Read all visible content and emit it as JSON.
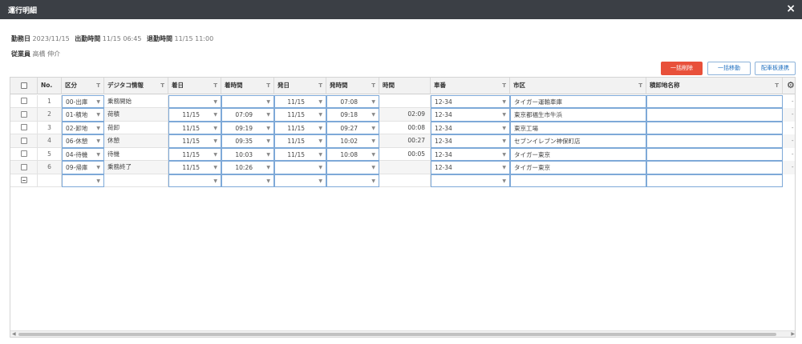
{
  "window": {
    "title": "運行明細",
    "close_icon": "×"
  },
  "info": {
    "work_date_label": "勤務日",
    "work_date": "2023/11/15",
    "clock_in_label": "出勤時間",
    "clock_in": "11/15 06:45",
    "clock_out_label": "退勤時間",
    "clock_out": "11/15 11:00",
    "employee_label": "従業員",
    "employee": "高橋 伸介"
  },
  "actions": {
    "bulk_delete": "一括削除",
    "bulk_move": "一括移動",
    "dispatch_link": "配車板連携"
  },
  "colors": {
    "titlebar": "#3b3f45",
    "danger": "#e8503a",
    "accent": "#1e6fc0"
  },
  "columns": {
    "no": "No.",
    "kubun": "区分",
    "digitaco": "デジタコ情報",
    "arrive_date": "着日",
    "arrive_time": "着時間",
    "depart_date": "発日",
    "depart_time": "発時間",
    "duration": "時間",
    "vehicle": "車番",
    "city": "市区",
    "place": "積卸地名称",
    "filter_icon": "T",
    "settings_icon": "⚙"
  },
  "rows": [
    {
      "no": "1",
      "kubun": "00-出庫",
      "digitaco": "乗務開始",
      "arrive_date": "",
      "arrive_time": "",
      "depart_date": "11/15",
      "depart_time": "07:08",
      "duration": "",
      "vehicle": "12-34",
      "city": "タイガー運輸車庫",
      "place": ""
    },
    {
      "no": "2",
      "kubun": "01-積地",
      "digitaco": "荷積",
      "arrive_date": "11/15",
      "arrive_time": "07:09",
      "depart_date": "11/15",
      "depart_time": "09:18",
      "duration": "02:09",
      "vehicle": "12-34",
      "city": "東京都福生市牛浜",
      "place": ""
    },
    {
      "no": "3",
      "kubun": "02-卸地",
      "digitaco": "荷卸",
      "arrive_date": "11/15",
      "arrive_time": "09:19",
      "depart_date": "11/15",
      "depart_time": "09:27",
      "duration": "00:08",
      "vehicle": "12-34",
      "city": "東京工場",
      "place": ""
    },
    {
      "no": "4",
      "kubun": "06-休憩",
      "digitaco": "休憩",
      "arrive_date": "11/15",
      "arrive_time": "09:35",
      "depart_date": "11/15",
      "depart_time": "10:02",
      "duration": "00:27",
      "vehicle": "12-34",
      "city": "セブンイレブン神保町店",
      "place": ""
    },
    {
      "no": "5",
      "kubun": "04-待機",
      "digitaco": "待機",
      "arrive_date": "11/15",
      "arrive_time": "10:03",
      "depart_date": "11/15",
      "depart_time": "10:08",
      "duration": "00:05",
      "vehicle": "12-34",
      "city": "タイガー東京",
      "place": ""
    },
    {
      "no": "6",
      "kubun": "09-帰庫",
      "digitaco": "乗務終了",
      "arrive_date": "11/15",
      "arrive_time": "10:26",
      "depart_date": "",
      "depart_time": "",
      "duration": "",
      "vehicle": "12-34",
      "city": "タイガー東京",
      "place": ""
    }
  ],
  "row_menu_icon": "-",
  "scroll": {
    "left_arrow": "◀",
    "right_arrow": "▶"
  }
}
